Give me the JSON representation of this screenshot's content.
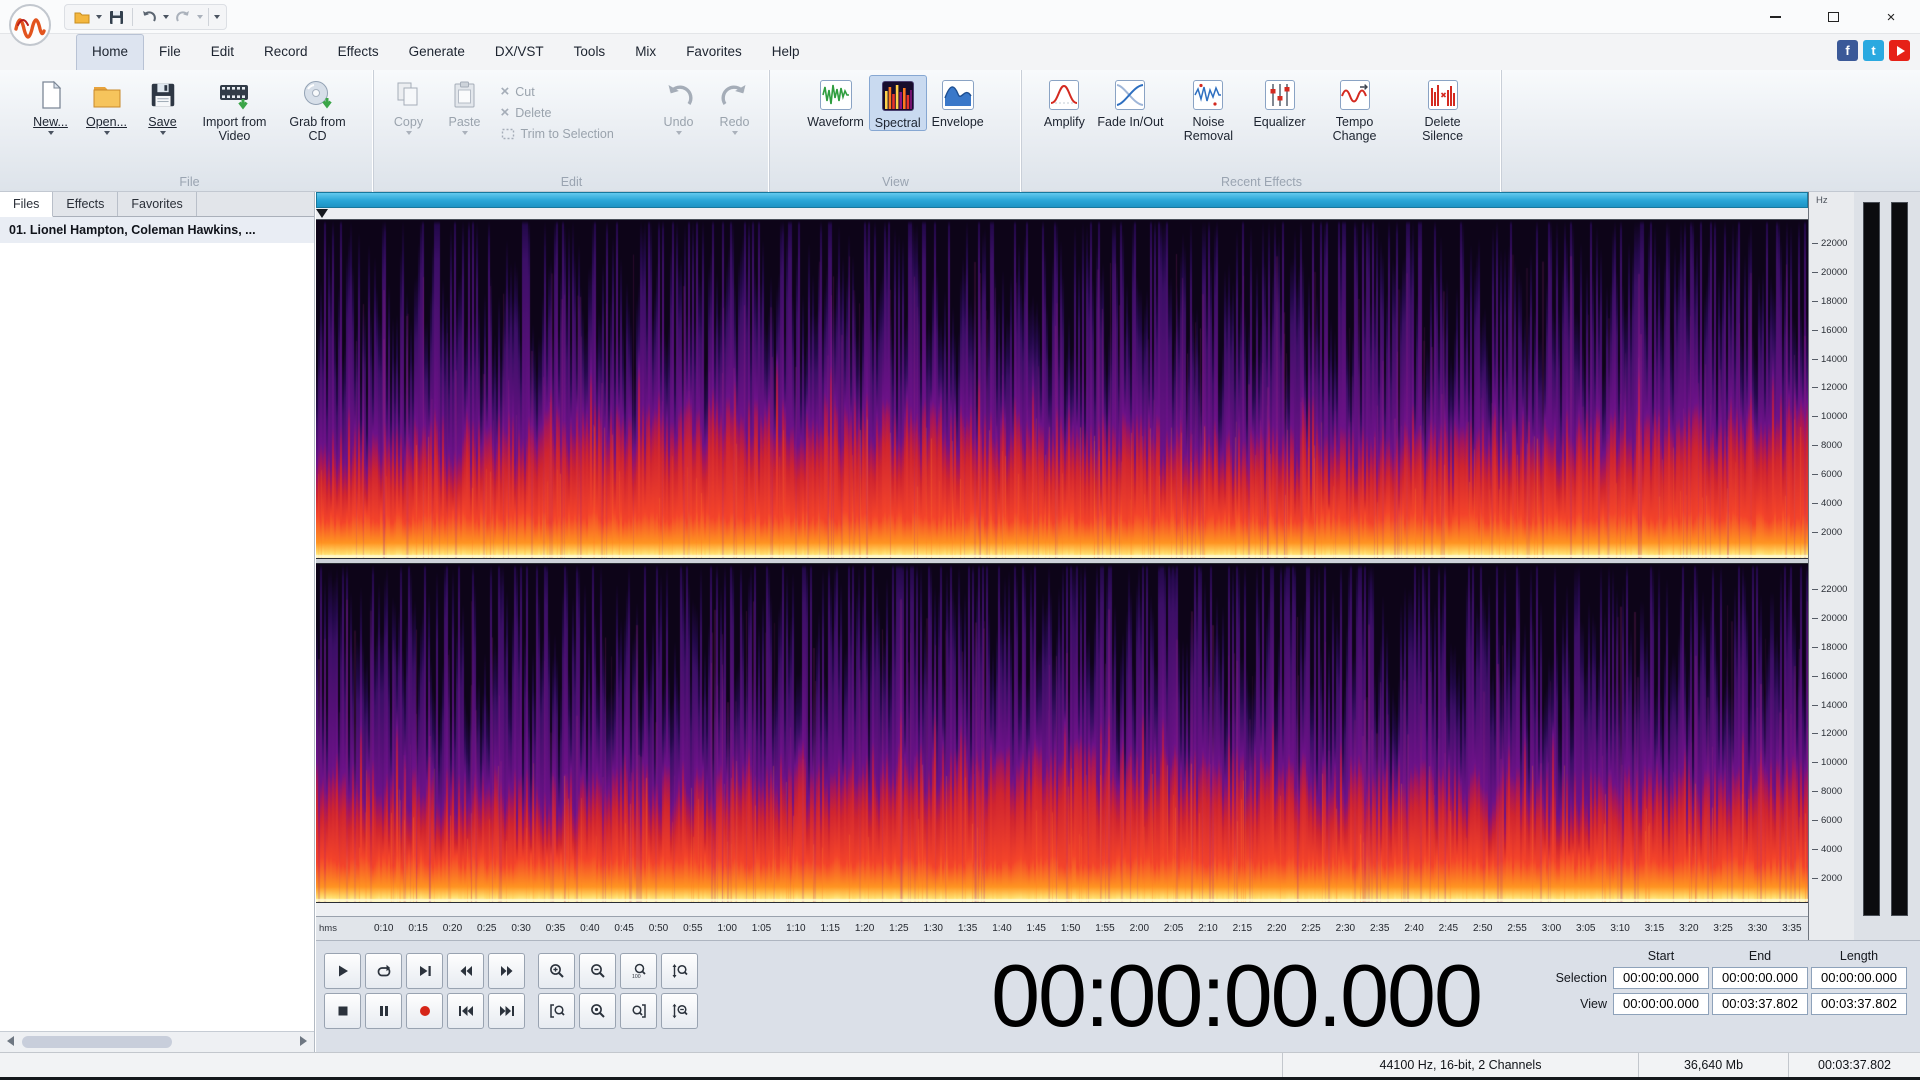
{
  "window": {
    "close_glyph": "×"
  },
  "menu": {
    "tabs": [
      "Home",
      "File",
      "Edit",
      "Record",
      "Effects",
      "Generate",
      "DX/VST",
      "Tools",
      "Mix",
      "Favorites",
      "Help"
    ],
    "active_tab": "Home"
  },
  "social": {
    "facebook": "f",
    "twitter": "t"
  },
  "ribbon": {
    "file": {
      "group_label": "File",
      "new": "New...",
      "open": "Open...",
      "save": "Save",
      "import_video": "Import from Video",
      "grab_cd": "Grab from CD"
    },
    "edit": {
      "group_label": "Edit",
      "copy": "Copy",
      "paste": "Paste",
      "cut": "Cut",
      "del": "Delete",
      "trim": "Trim to Selection",
      "undo": "Undo",
      "redo": "Redo"
    },
    "view": {
      "group_label": "View",
      "waveform": "Waveform",
      "spectral": "Spectral",
      "envelope": "Envelope",
      "active": "Spectral"
    },
    "effects": {
      "group_label": "Recent Effects",
      "amplify": "Amplify",
      "fade": "Fade In/Out",
      "noise": "Noise Removal",
      "equalizer": "Equalizer",
      "tempo": "Tempo Change",
      "silence": "Delete Silence"
    }
  },
  "icons": {
    "cut_glyph": "×",
    "delete_glyph": "×"
  },
  "sidebar": {
    "tabs": [
      "Files",
      "Effects",
      "Favorites"
    ],
    "active_tab": "Files",
    "items": [
      "01. Lionel Hampton, Coleman Hawkins, ..."
    ]
  },
  "spectrogram": {
    "freq_unit": "Hz",
    "time_unit": "hms",
    "channels": 2,
    "freq_ticks": [
      "22000",
      "20000",
      "18000",
      "16000",
      "14000",
      "12000",
      "10000",
      "8000",
      "6000",
      "4000",
      "2000"
    ],
    "time_ticks": [
      "0:10",
      "0:15",
      "0:20",
      "0:25",
      "0:30",
      "0:35",
      "0:40",
      "0:45",
      "0:50",
      "0:55",
      "1:00",
      "1:05",
      "1:10",
      "1:15",
      "1:20",
      "1:25",
      "1:30",
      "1:35",
      "1:40",
      "1:45",
      "1:50",
      "1:55",
      "2:00",
      "2:05",
      "2:10",
      "2:15",
      "2:20",
      "2:25",
      "2:30",
      "2:35",
      "2:40",
      "2:45",
      "2:50",
      "2:55",
      "3:00",
      "3:05",
      "3:10",
      "3:15",
      "3:20",
      "3:25",
      "3:30",
      "3:35"
    ],
    "palette": {
      "background": "#0d0418",
      "base": "#fff8c8",
      "bright": "#ffdf6e",
      "orange": "#ff9422",
      "red": "#f4442a",
      "deep_red": "#cf2430",
      "magenta": "#a4155c",
      "purple": "#6d1288",
      "violet": "#3b0f66",
      "dark_violet": "#23094a"
    }
  },
  "transport": {
    "buttons": [
      "play",
      "loop",
      "skip-to-end",
      "rewind",
      "fast-forward",
      "stop",
      "pause",
      "record",
      "go-to-start",
      "go-to-end"
    ]
  },
  "zoom": {
    "buttons": [
      "zoom-in",
      "zoom-out",
      "zoom-100",
      "zoom-vertical",
      "zoom-selection",
      "zoom-full",
      "zoom-project",
      "zoom-vertical-out"
    ]
  },
  "time_display": {
    "value": "00:00:00.000"
  },
  "selection_panel": {
    "headers": [
      "Start",
      "End",
      "Length"
    ],
    "rows": [
      {
        "label": "Selection",
        "start": "00:00:00.000",
        "end": "00:00:00.000",
        "length": "00:00:00.000"
      },
      {
        "label": "View",
        "start": "00:00:00.000",
        "end": "00:03:37.802",
        "length": "00:03:37.802"
      }
    ]
  },
  "status_bar": {
    "format": "44100 Hz, 16-bit, 2 Channels",
    "file_size": "36,640 Mb",
    "duration": "00:03:37.802"
  }
}
